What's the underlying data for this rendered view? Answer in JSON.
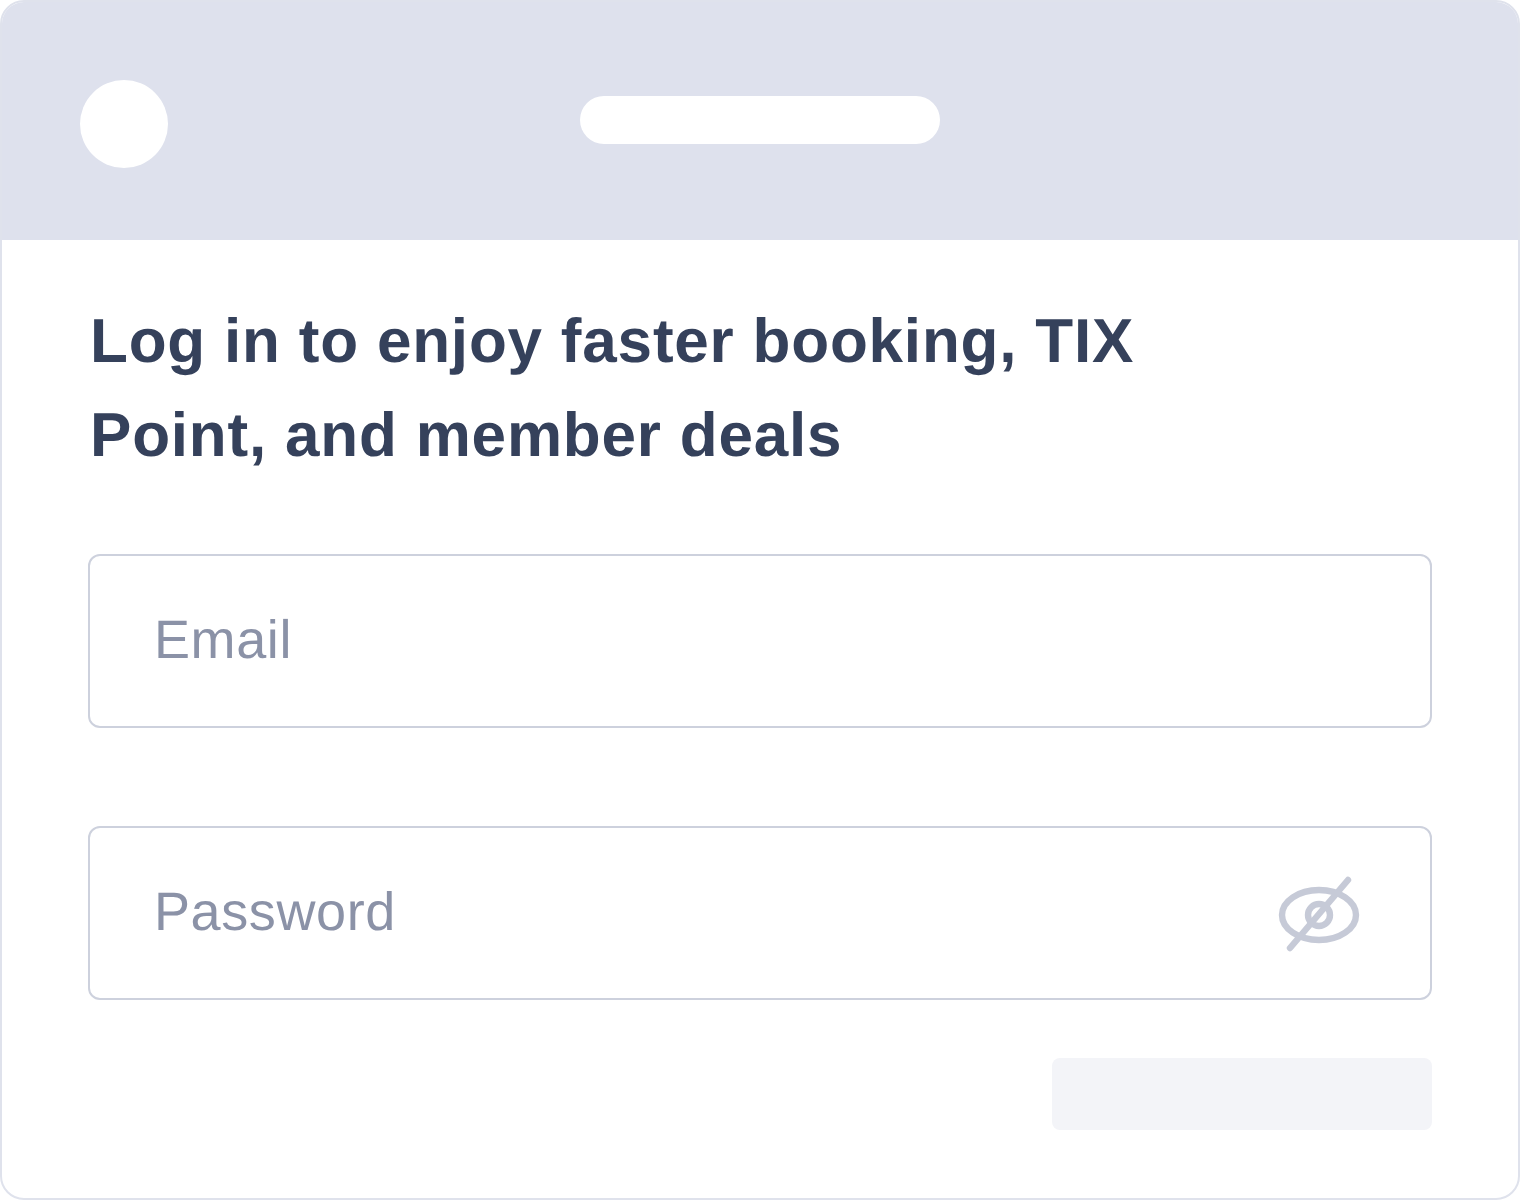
{
  "heading": "Log in to enjoy faster booking, TIX Point, and member deals",
  "fields": [
    {
      "kind": "email",
      "placeholder": "Email"
    },
    {
      "kind": "password",
      "placeholder": "Password",
      "revealed": false
    }
  ]
}
